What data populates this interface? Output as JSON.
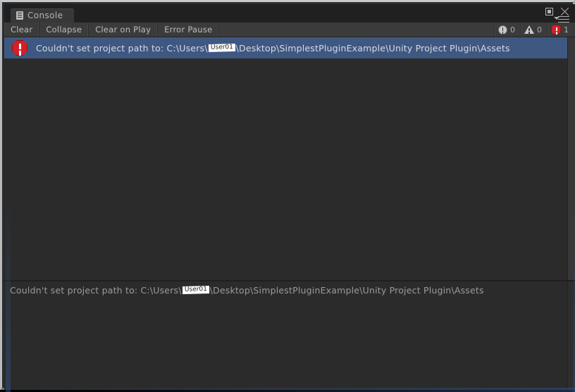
{
  "window": {
    "title": "Console",
    "tab_icon": "console-icon",
    "maximize_label": "Maximize",
    "close_label": "Close",
    "menu_label": "Panel menu"
  },
  "toolbar": {
    "buttons": [
      {
        "label": "Clear"
      },
      {
        "label": "Collapse"
      },
      {
        "label": "Clear on Play"
      },
      {
        "label": "Error Pause"
      }
    ],
    "counters": [
      {
        "icon": "info-icon",
        "count": "0"
      },
      {
        "icon": "warning-icon",
        "count": "0"
      },
      {
        "icon": "error-icon",
        "count": "1"
      }
    ]
  },
  "log": {
    "entries": [
      {
        "severity": "error",
        "icon": "error-icon",
        "prefix": "Couldn't set project path to: C:\\Users\\",
        "redacted": "User01",
        "suffix": "\\Desktop\\SimplestPluginExample\\Unity Project Plugin\\Assets",
        "selected": true
      }
    ]
  },
  "detail": {
    "prefix": "Couldn't set project path to: C:\\Users\\",
    "redacted": "User01",
    "suffix": "\\Desktop\\SimplestPluginExample\\Unity Project Plugin\\Assets"
  },
  "colors": {
    "selection": "#3f5882",
    "error": "#d31f26",
    "panel": "#2b2b2b",
    "toolbar": "#3b3b3b",
    "titlebar": "#202020",
    "text": "#bdbdbd"
  }
}
